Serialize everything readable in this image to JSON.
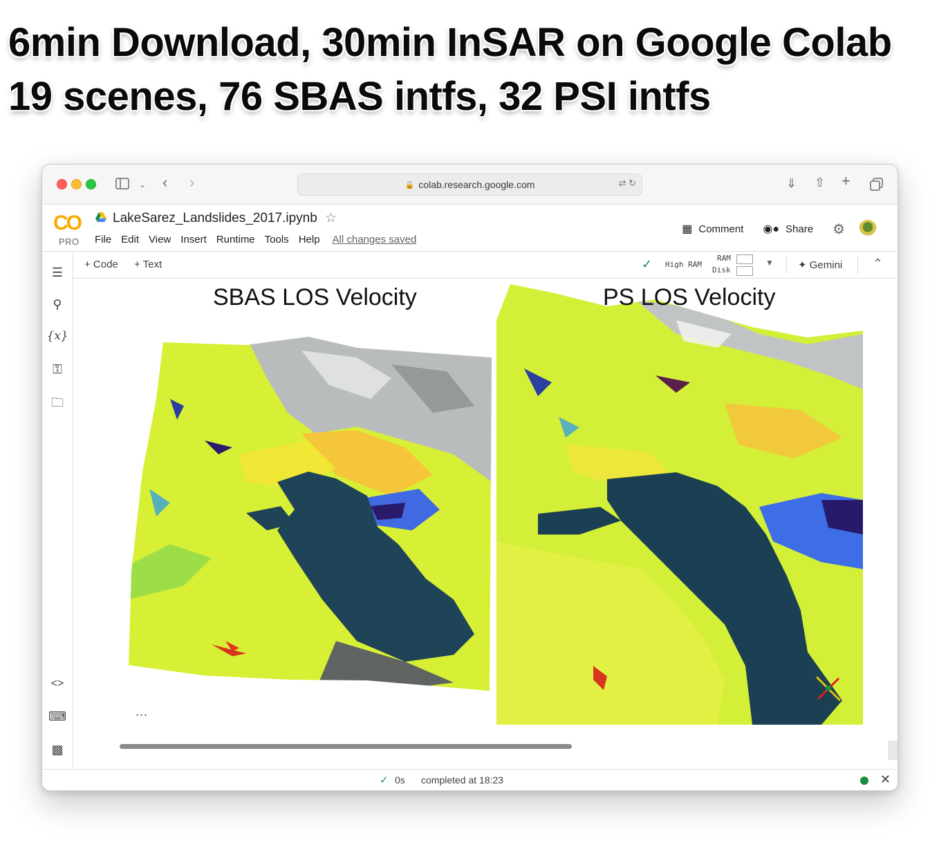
{
  "headline": {
    "line1": "6min Download, 30min InSAR on Google Colab",
    "line2": "19 scenes, 76 SBAS intfs, 32 PSI intfs"
  },
  "browser": {
    "url": "colab.research.google.com",
    "traffic_lights": [
      "#ff5f57",
      "#febc2e",
      "#28c840"
    ],
    "icons": [
      "sidebar-icon",
      "chevron-down-icon",
      "back-icon",
      "forward-icon",
      "lock-icon",
      "translate-icon",
      "reload-icon",
      "download-icon",
      "share-icon",
      "new-tab-icon",
      "tabs-icon"
    ]
  },
  "colab": {
    "logo": "CO",
    "plan": "PRO",
    "notebook_title": "LakeSarez_Landslides_2017.ipynb",
    "menu": [
      "File",
      "Edit",
      "View",
      "Insert",
      "Runtime",
      "Tools",
      "Help"
    ],
    "save_status": "All changes saved",
    "comment_label": "Comment",
    "share_label": "Share"
  },
  "toolbar": {
    "add_code": "+ Code",
    "add_text": "+ Text",
    "runtime_type": "High RAM",
    "ram_label": "RAM",
    "disk_label": "Disk",
    "gemini_label": "Gemini"
  },
  "rail_icons": [
    "toc-icon",
    "search-icon",
    "variables-icon",
    "secrets-key-icon",
    "folder-icon",
    "code-snippets-icon",
    "command-palette-icon",
    "terminal-icon"
  ],
  "output": {
    "left_title": "SBAS LOS Velocity",
    "right_title": "PS LOS Velocity",
    "ellipsis": "..."
  },
  "status": {
    "exec_time": "0s",
    "completed": "completed at 18:23"
  },
  "colors": {
    "accent_green": "#1e8e3e",
    "colab_orange": "#e8710a",
    "colab_yellow": "#f9ab00",
    "velocity_base": "#d6f030",
    "lake": "#1f3f52"
  }
}
